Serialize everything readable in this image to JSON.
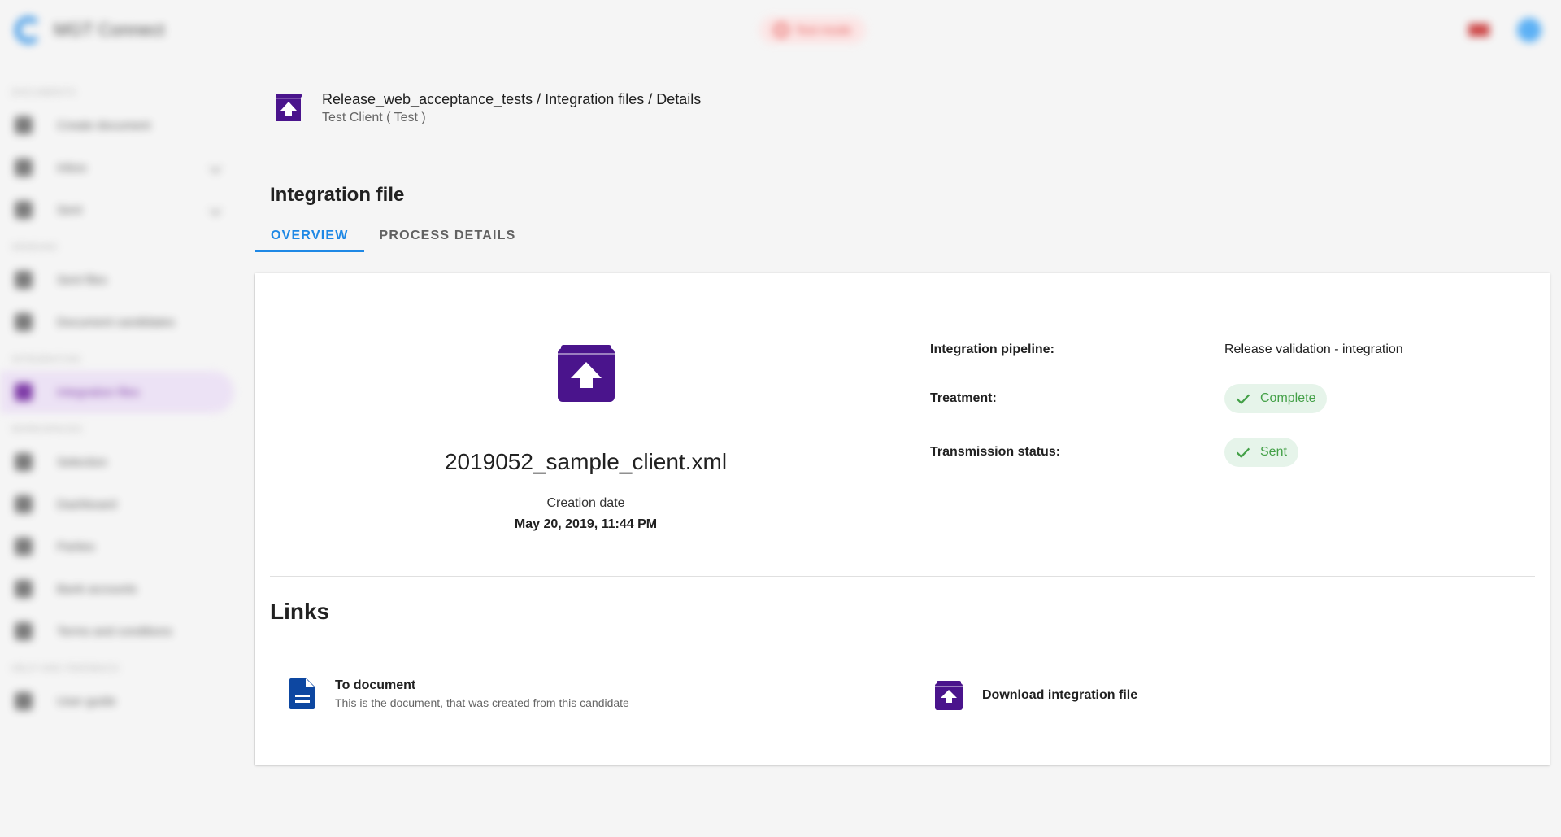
{
  "app": {
    "name": "MGT Connect",
    "mode_badge": "Test mode"
  },
  "sidebar": {
    "sections": [
      {
        "title": "Documents",
        "items": [
          {
            "label": "Create document",
            "icon": "plus-icon"
          },
          {
            "label": "Inbox",
            "icon": "inbox-icon"
          },
          {
            "label": "Sent",
            "icon": "send-icon"
          }
        ]
      },
      {
        "title": "Sending",
        "items": [
          {
            "label": "Sent files",
            "icon": "file-icon"
          },
          {
            "label": "Document candidates",
            "icon": "document-candidates-icon"
          }
        ]
      },
      {
        "title": "Integration",
        "items": [
          {
            "label": "Integration files",
            "icon": "integration-icon",
            "active": true
          }
        ]
      },
      {
        "title": "Workspaces",
        "items": [
          {
            "label": "Selection",
            "icon": "selection-icon"
          },
          {
            "label": "Dashboard",
            "icon": "dashboard-icon"
          },
          {
            "label": "Parties",
            "icon": "parties-icon"
          },
          {
            "label": "Bank accounts",
            "icon": "bank-icon"
          },
          {
            "label": "Terms and conditions",
            "icon": "terms-icon"
          }
        ]
      },
      {
        "title": "Help and feedback",
        "items": [
          {
            "label": "User guide",
            "icon": "help-icon"
          }
        ]
      }
    ]
  },
  "header": {
    "breadcrumb": "Release_web_acceptance_tests / Integration files / Details",
    "client": "Test Client ( Test )"
  },
  "page": {
    "title": "Integration file",
    "tabs": [
      {
        "label": "OVERVIEW",
        "active": true
      },
      {
        "label": "PROCESS DETAILS",
        "active": false
      }
    ]
  },
  "overview": {
    "file_name": "2019052_sample_client.xml",
    "creation_label": "Creation date",
    "creation_value": "May 20, 2019, 11:44 PM",
    "pipeline_label": "Integration pipeline:",
    "pipeline_value": "Release validation - integration",
    "treatment_label": "Treatment:",
    "treatment_value": "Complete",
    "transmission_label": "Transmission status:",
    "transmission_value": "Sent"
  },
  "links": {
    "title": "Links",
    "to_document": {
      "title": "To document",
      "subtitle": "This is the document, that was created from this candidate"
    },
    "download": {
      "title": "Download integration file"
    }
  },
  "colors": {
    "accent": "#1e88e5",
    "integration_purple": "#4a148c",
    "document_blue": "#0d47a1",
    "success_green": "#43a047",
    "success_bg": "#e6f4ea"
  }
}
